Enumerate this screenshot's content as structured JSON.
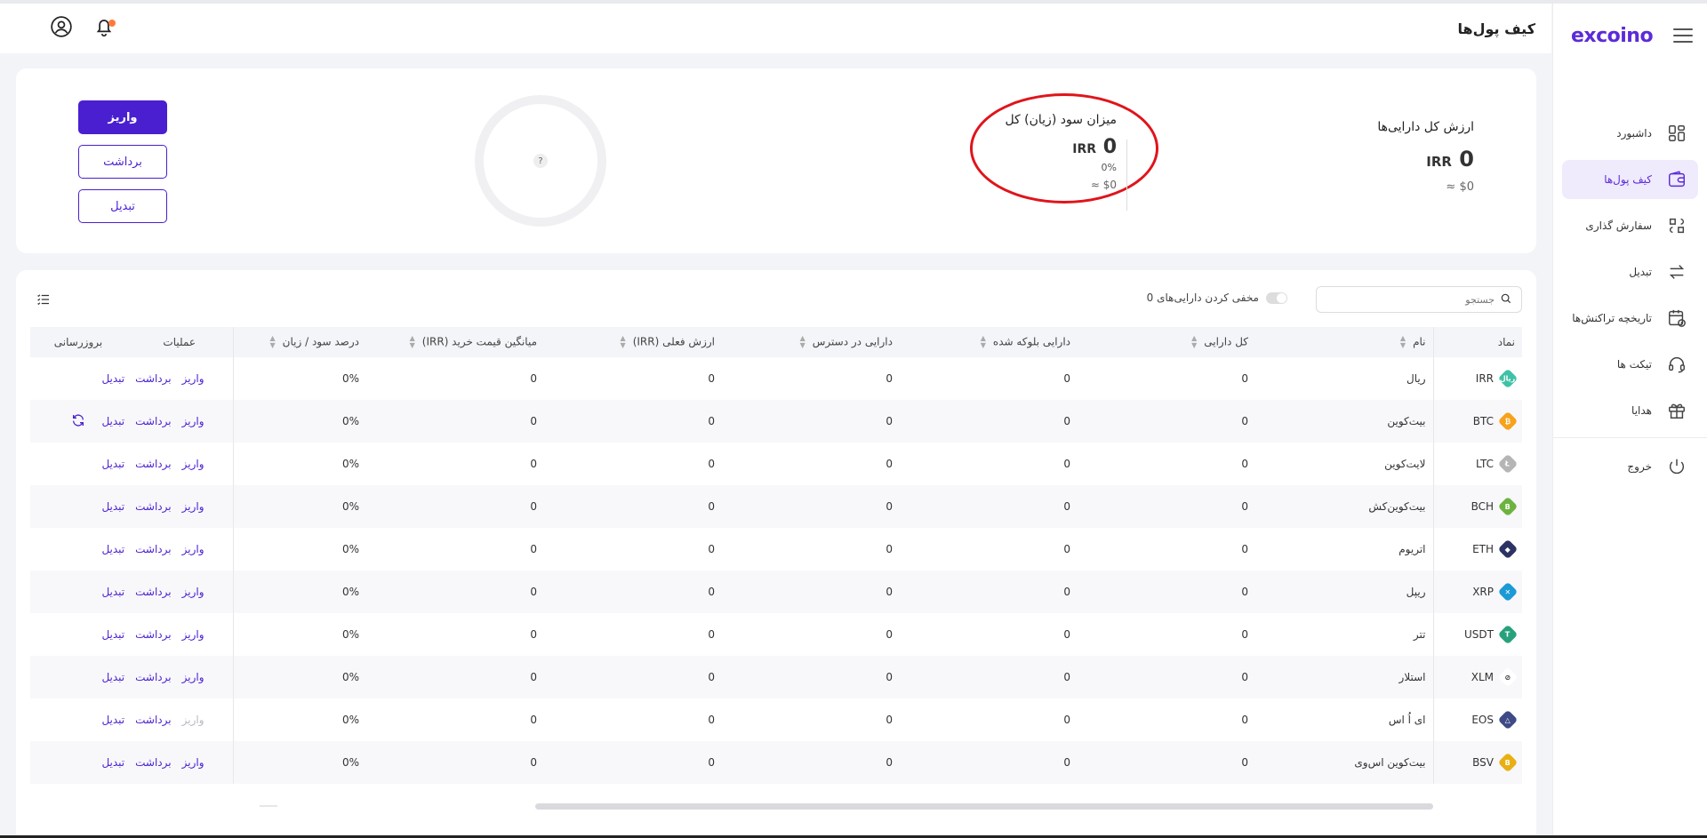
{
  "app": {
    "logo": "excoino",
    "page_title": "کیف پول‌ها"
  },
  "sidebar": {
    "items": [
      {
        "label": "داشبورد",
        "icon": "dashboard-icon",
        "active": false
      },
      {
        "label": "کیف پول‌ها",
        "icon": "wallet-icon",
        "active": true
      },
      {
        "label": "سفارش گذاری",
        "icon": "order-icon",
        "active": false
      },
      {
        "label": "تبدیل",
        "icon": "exchange-icon",
        "active": false
      },
      {
        "label": "تاریخچه تراکنش‌ها",
        "icon": "history-icon",
        "active": false
      },
      {
        "label": "تیکت ها",
        "icon": "headset-icon",
        "active": false
      },
      {
        "label": "هدایا",
        "icon": "gift-icon",
        "active": false
      }
    ],
    "logout": "خروج"
  },
  "summary": {
    "total_label": "ارزش کل دارایی‌ها",
    "total_value": "0",
    "total_unit": "IRR",
    "total_usd": "≈ $0",
    "profit_label": "میزان سود (زیان) کل",
    "profit_value": "0",
    "profit_unit": "IRR",
    "profit_pct": "0%",
    "profit_usd": "≈ $0",
    "chart_placeholder": "?"
  },
  "actions": {
    "deposit": "واریز",
    "withdraw": "برداشت",
    "convert": "تبدیل"
  },
  "tools": {
    "search_placeholder": "جستجو",
    "hide_label": "مخفی کردن دارایی‌های 0"
  },
  "table": {
    "headers": {
      "symbol": "نماد",
      "name": "نام",
      "total": "کل دارایی",
      "blocked": "دارایی بلوکه شده",
      "available": "دارایی در دسترس",
      "current_value": "ارزش فعلی (IRR)",
      "avg_price": "میانگین قیمت خرید (IRR)",
      "pnl_pct": "درصد سود / زیان",
      "operations": "عملیات",
      "update": "بروزرسانی"
    },
    "op_labels": {
      "deposit": "واریز",
      "withdraw": "برداشت",
      "convert": "تبدیل"
    },
    "rows": [
      {
        "symbol": "IRR",
        "name": "ریال",
        "total": "0",
        "blocked": "0",
        "available": "0",
        "current": "0",
        "avg": "0",
        "pct": "0%",
        "color": "#3fc1a5",
        "glyph": "ریال",
        "refresh": false,
        "deposit_enabled": true
      },
      {
        "symbol": "BTC",
        "name": "بیت‌کوین",
        "total": "0",
        "blocked": "0",
        "available": "0",
        "current": "0",
        "avg": "0",
        "pct": "0%",
        "color": "#f7a21b",
        "glyph": "₿",
        "refresh": true,
        "deposit_enabled": true
      },
      {
        "symbol": "LTC",
        "name": "لایت‌کوین",
        "total": "0",
        "blocked": "0",
        "available": "0",
        "current": "0",
        "avg": "0",
        "pct": "0%",
        "color": "#b5b5b5",
        "glyph": "Ł",
        "refresh": false,
        "deposit_enabled": true
      },
      {
        "symbol": "BCH",
        "name": "بیت‌کوین‌کش",
        "total": "0",
        "blocked": "0",
        "available": "0",
        "current": "0",
        "avg": "0",
        "pct": "0%",
        "color": "#6cb33f",
        "glyph": "B",
        "refresh": false,
        "deposit_enabled": true
      },
      {
        "symbol": "ETH",
        "name": "اتریوم",
        "total": "0",
        "blocked": "0",
        "available": "0",
        "current": "0",
        "avg": "0",
        "pct": "0%",
        "color": "#2c3263",
        "glyph": "◆",
        "refresh": false,
        "deposit_enabled": true
      },
      {
        "symbol": "XRP",
        "name": "ریپل",
        "total": "0",
        "blocked": "0",
        "available": "0",
        "current": "0",
        "avg": "0",
        "pct": "0%",
        "color": "#1b9ad6",
        "glyph": "✕",
        "refresh": false,
        "deposit_enabled": true
      },
      {
        "symbol": "USDT",
        "name": "تتر",
        "total": "0",
        "blocked": "0",
        "available": "0",
        "current": "0",
        "avg": "0",
        "pct": "0%",
        "color": "#27a17c",
        "glyph": "T",
        "refresh": false,
        "deposit_enabled": true
      },
      {
        "symbol": "XLM",
        "name": "استلار",
        "total": "0",
        "blocked": "0",
        "available": "0",
        "current": "0",
        "avg": "0",
        "pct": "0%",
        "color": "#ffffff",
        "glyph": "⊘",
        "refresh": false,
        "deposit_enabled": true
      },
      {
        "symbol": "EOS",
        "name": "ای اُ اس",
        "total": "0",
        "blocked": "0",
        "available": "0",
        "current": "0",
        "avg": "0",
        "pct": "0%",
        "color": "#3d4a85",
        "glyph": "△",
        "refresh": false,
        "deposit_enabled": false
      },
      {
        "symbol": "BSV",
        "name": "بیت‌کوین اس‌وی",
        "total": "0",
        "blocked": "0",
        "available": "0",
        "current": "0",
        "avg": "0",
        "pct": "0%",
        "color": "#e8b012",
        "glyph": "B",
        "refresh": false,
        "deposit_enabled": true
      }
    ]
  },
  "colors": {
    "accent": "#4a1fd0",
    "highlight_ring": "#e0141b",
    "notification_dot": "#ff7a3d"
  }
}
